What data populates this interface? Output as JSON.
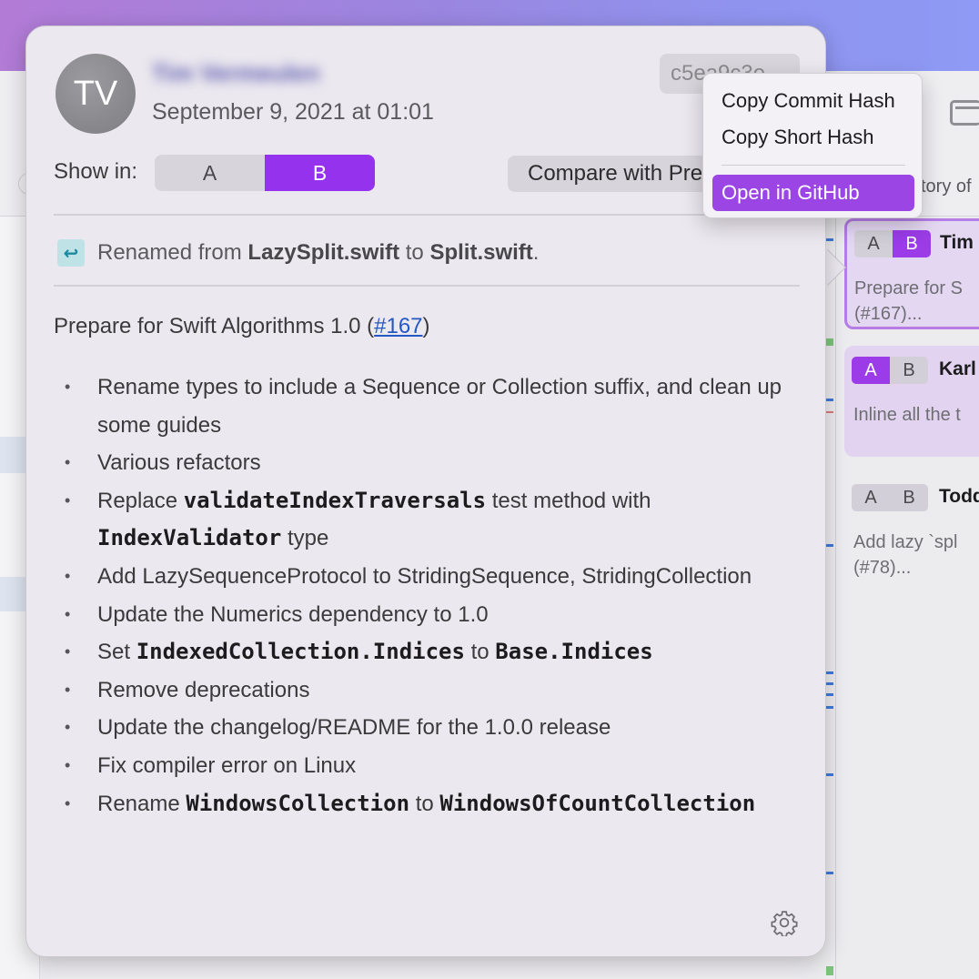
{
  "popover": {
    "avatar_initials": "TV",
    "author_name": "Tim Vermeulen",
    "date": "September 9, 2021 at 01:01",
    "hash_chip": "c5ea9c3e",
    "show_in_label": "Show in:",
    "show_in_options": [
      "A",
      "B"
    ],
    "show_in_selected": "B",
    "compare_button": "Compare with Previous",
    "rename": {
      "prefix": "Renamed from ",
      "from": "LazySplit.swift",
      "middle": " to ",
      "to": "Split.swift",
      "suffix": "."
    },
    "summary": {
      "text": "Prepare for Swift Algorithms 1.0 (",
      "link": "#167",
      "close": ")"
    },
    "bullets": [
      {
        "parts": [
          {
            "t": "Rename types to include a Sequence or Collection suffix, and clean up some guides"
          }
        ]
      },
      {
        "parts": [
          {
            "t": "Various refactors"
          }
        ]
      },
      {
        "parts": [
          {
            "t": "Replace "
          },
          {
            "t": "validateIndexTraversals",
            "code": true
          },
          {
            "t": " test method with "
          },
          {
            "t": "IndexValidator",
            "code": true
          },
          {
            "t": " type"
          }
        ]
      },
      {
        "parts": [
          {
            "t": "Add LazySequenceProtocol to StridingSequence, StridingCollection"
          }
        ]
      },
      {
        "parts": [
          {
            "t": "Update the Numerics dependency to 1.0"
          }
        ]
      },
      {
        "parts": [
          {
            "t": "Set "
          },
          {
            "t": "IndexedCollection.Indices",
            "code": true
          },
          {
            "t": " to "
          },
          {
            "t": "Base.Indices",
            "code": true
          }
        ]
      },
      {
        "parts": [
          {
            "t": "Remove deprecations"
          }
        ]
      },
      {
        "parts": [
          {
            "t": "Update the changelog/README for the 1.0.0 release"
          }
        ]
      },
      {
        "parts": [
          {
            "t": "Fix compiler error on Linux"
          }
        ]
      },
      {
        "parts": [
          {
            "t": "Rename "
          },
          {
            "t": "WindowsCollection",
            "code": true
          },
          {
            "t": " to "
          },
          {
            "t": "WindowsOfCountCollection",
            "code": true
          }
        ]
      }
    ],
    "settings_icon": "gear-icon"
  },
  "context_menu": {
    "items": [
      "Copy Commit Hash",
      "Copy Short Hash",
      "Open in GitHub"
    ],
    "highlighted": "Open in GitHub"
  },
  "background": {
    "history_label": "tory of",
    "cards": [
      {
        "a": "A",
        "b": "B",
        "active": "B",
        "author": "Tim",
        "message": "Prepare for S",
        "message2": "(#167)..."
      },
      {
        "a": "A",
        "b": "B",
        "active": "A",
        "author": "Karl",
        "message": "Inline all the t",
        "message2": ""
      },
      {
        "a": "A",
        "b": "B",
        "active": "",
        "author": "Todd",
        "message": "Add lazy `spl",
        "message2": "(#78)..."
      }
    ]
  },
  "colors": {
    "accent_purple": "#9532ee",
    "menu_highlight": "#9a45e4",
    "link_blue": "#2457c5"
  }
}
